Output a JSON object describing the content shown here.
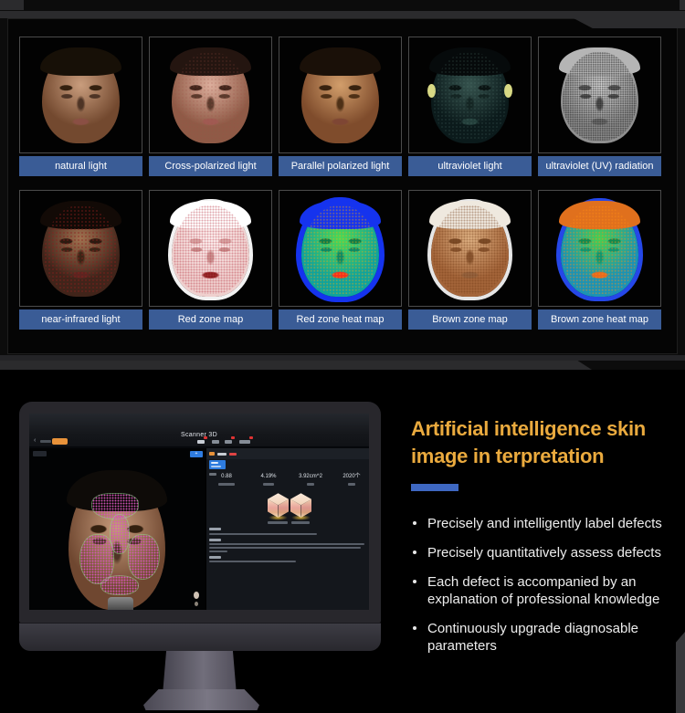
{
  "top_panel": {
    "cards": [
      {
        "label": "natural light"
      },
      {
        "label": "Cross-polarized light"
      },
      {
        "label": "Parallel polarized light"
      },
      {
        "label": "ultraviolet light"
      },
      {
        "label": "ultraviolet (UV) radiation"
      },
      {
        "label": "near-infrared light"
      },
      {
        "label": "Red zone map"
      },
      {
        "label": "Red zone heat map"
      },
      {
        "label": "Brown zone map"
      },
      {
        "label": "Brown zone heat map"
      }
    ],
    "label_bar_color": "#3a5c96"
  },
  "monitor": {
    "screen": {
      "title": "Scanner 3D",
      "stats": [
        "0.88",
        "4.19%",
        "3.92cm^2",
        "2020个"
      ]
    }
  },
  "right_section": {
    "heading_line1": "Artificial intelligence skin",
    "heading_line2": "image in terpretation",
    "bullets": [
      "Precisely and intelligently label defects",
      "Precisely quantitatively assess defects",
      "Each defect is accompanied by an explanation of professional knowledge",
      "Continuously upgrade diagnosable parameters"
    ],
    "accent_color": "#eaaa3e",
    "underline_color": "#3e68c2"
  }
}
